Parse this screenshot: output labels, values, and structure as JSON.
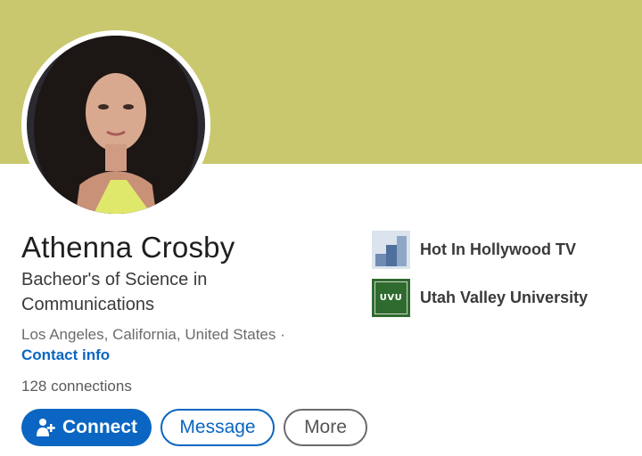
{
  "profile": {
    "name": "Athenna Crosby",
    "headline": "Bacheor's of Science in Communications",
    "location": "Los Angeles, California, United States ·",
    "contact_label": "Contact info",
    "connections": "128 connections"
  },
  "actions": {
    "connect_label": "Connect",
    "message_label": "Message",
    "more_label": "More"
  },
  "experience": [
    {
      "label": "Hot In Hollywood TV",
      "logo": "building-logo-icon"
    },
    {
      "label": "Utah Valley University",
      "logo": "uvu-logo",
      "logo_text": "UVU"
    }
  ],
  "colors": {
    "banner": "#c9c86f",
    "accent": "#0a66c2",
    "uvu_green": "#2f6b2f"
  }
}
